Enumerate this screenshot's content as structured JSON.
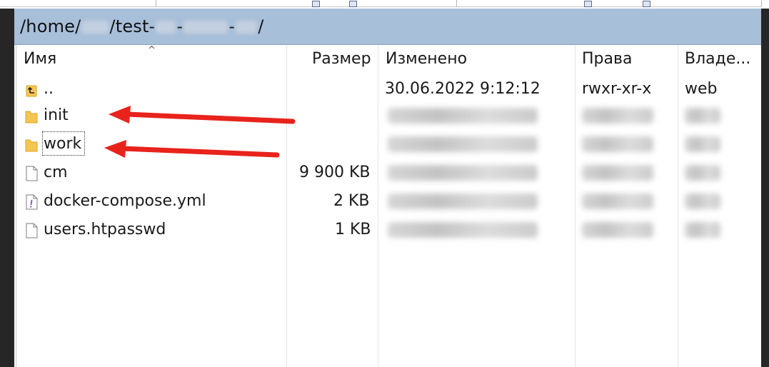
{
  "window": {
    "path": {
      "prefix": "/home/",
      "mid1": "/test-",
      "dash1": "-",
      "dash2": "-",
      "suffix": "/"
    }
  },
  "columns": {
    "name": "Имя",
    "size": "Размер",
    "modified": "Изменено",
    "rights": "Права",
    "owner": "Владе..."
  },
  "files": [
    {
      "name": "..",
      "icon": "parent-folder-icon",
      "size": "",
      "modified": "30.06.2022 9:12:12",
      "rights": "rwxr-xr-x",
      "owner": "web",
      "redacted": false
    },
    {
      "name": "init",
      "icon": "folder-icon",
      "size": "",
      "modified": "",
      "rights": "",
      "owner": "",
      "redacted": true
    },
    {
      "name": "work",
      "icon": "folder-icon",
      "size": "",
      "modified": "",
      "rights": "",
      "owner": "",
      "redacted": true
    },
    {
      "name": "cm",
      "icon": "file-icon",
      "size": "9 900 KB",
      "modified": "",
      "rights": "",
      "owner": "",
      "redacted": true
    },
    {
      "name": "docker-compose.yml",
      "icon": "config-file-icon",
      "size": "2 KB",
      "modified": "",
      "rights": "",
      "owner": "",
      "redacted": true
    },
    {
      "name": "users.htpasswd",
      "icon": "file-icon",
      "size": "1 KB",
      "modified": "",
      "rights": "",
      "owner": "",
      "redacted": true
    }
  ],
  "annotations": {
    "arrow_color": "#e8231c",
    "targets": [
      "init",
      "work"
    ]
  },
  "colors": {
    "path_bar": "#a8bfd9",
    "folder": "#f5c64f",
    "frame": "#262626"
  }
}
